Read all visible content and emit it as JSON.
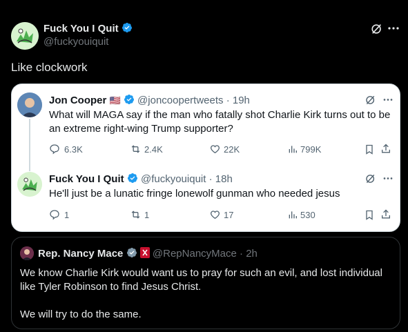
{
  "main": {
    "display_name": "Fuck You I Quit",
    "handle": "@fuckyouiquit",
    "text": "Like clockwork"
  },
  "card": {
    "tweet1": {
      "display_name": "Jon Cooper",
      "flag": "🇺🇸",
      "handle": "@joncoopertweets",
      "time": "· 19h",
      "text": "What will MAGA say if the man who fatally shot Charlie Kirk turns out to be an extreme right-wing Trump supporter?",
      "replies": "6.3K",
      "reposts": "2.4K",
      "likes": "22K",
      "views": "799K"
    },
    "tweet2": {
      "display_name": "Fuck You I Quit",
      "handle": "@fuckyouiquit",
      "time": "· 18h",
      "text": "He'll just be a lunatic fringe lonewolf gunman who needed jesus",
      "replies": "1",
      "reposts": "1",
      "likes": "17",
      "views": "530"
    }
  },
  "quote": {
    "display_name": "Rep. Nancy Mace",
    "handle": "@RepNancyMace",
    "time": "· 2h",
    "text1": "We know Charlie Kirk would want us to pray for such an evil, and lost individual like Tyler Robinson to find Jesus Christ.",
    "text2": "We will try to do the same."
  },
  "colors": {
    "background": "#000000",
    "verified_blue": "#1d9bf0",
    "verified_gray": "#829aab",
    "text": "#e7e9ea",
    "muted": "#71767b"
  }
}
